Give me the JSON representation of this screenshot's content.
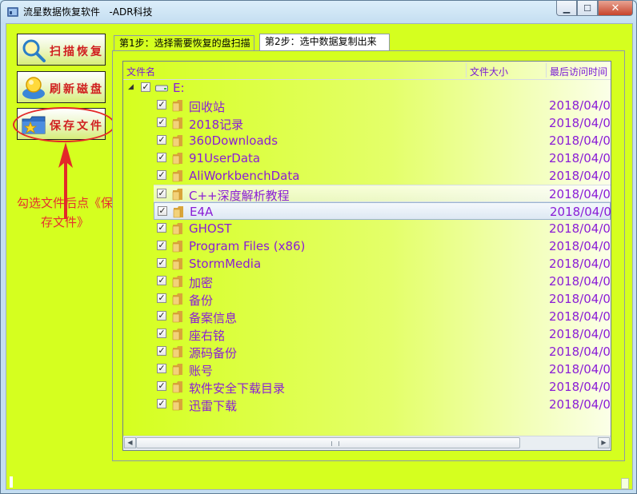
{
  "window": {
    "title": "流星数据恢复软件   -ADR科技"
  },
  "sidebar": {
    "buttons": [
      {
        "label": "扫描恢复",
        "icon": "magnifier-icon"
      },
      {
        "label": "刷新磁盘",
        "icon": "bulb-icon"
      },
      {
        "label": "保存文件",
        "icon": "folder-star-icon"
      }
    ],
    "annotation": "勾选文件后点《保存文件》"
  },
  "tabs": [
    {
      "label": "第1步：选择需要恢复的盘扫描",
      "active": false
    },
    {
      "label": "第2步：选中数据复制出来",
      "active": true
    }
  ],
  "list": {
    "columns": [
      "文件名",
      "文件大小",
      "最后访问时间"
    ],
    "root": {
      "name": "E:",
      "checked": true
    },
    "items": [
      {
        "name": "回收站",
        "date": "2018/04/0"
      },
      {
        "name": "2018记录",
        "date": "2018/04/0"
      },
      {
        "name": "360Downloads",
        "date": "2018/04/0"
      },
      {
        "name": "91UserData",
        "date": "2018/04/0"
      },
      {
        "name": "AliWorkbenchData",
        "date": "2018/04/0"
      },
      {
        "name": "C++深度解析教程",
        "date": "2018/04/0"
      },
      {
        "name": "E4A",
        "date": "2018/04/0"
      },
      {
        "name": "GHOST",
        "date": "2018/04/0"
      },
      {
        "name": "Program Files (x86)",
        "date": "2018/04/0"
      },
      {
        "name": "StormMedia",
        "date": "2018/04/0"
      },
      {
        "name": "加密",
        "date": "2018/04/0"
      },
      {
        "name": "备份",
        "date": "2018/04/0"
      },
      {
        "name": "备案信息",
        "date": "2018/04/0"
      },
      {
        "name": "座右铭",
        "date": "2018/04/0"
      },
      {
        "name": "源码备份",
        "date": "2018/04/0"
      },
      {
        "name": "账号",
        "date": "2018/04/0"
      },
      {
        "name": "软件安全下载目录",
        "date": "2018/04/0"
      },
      {
        "name": "迅雷下载",
        "date": "2018/04/0"
      }
    ]
  },
  "colors": {
    "background": "#d5ff1f",
    "item_text": "#8a1dd6",
    "button_text": "#d02020",
    "annotation": "#e32929"
  }
}
